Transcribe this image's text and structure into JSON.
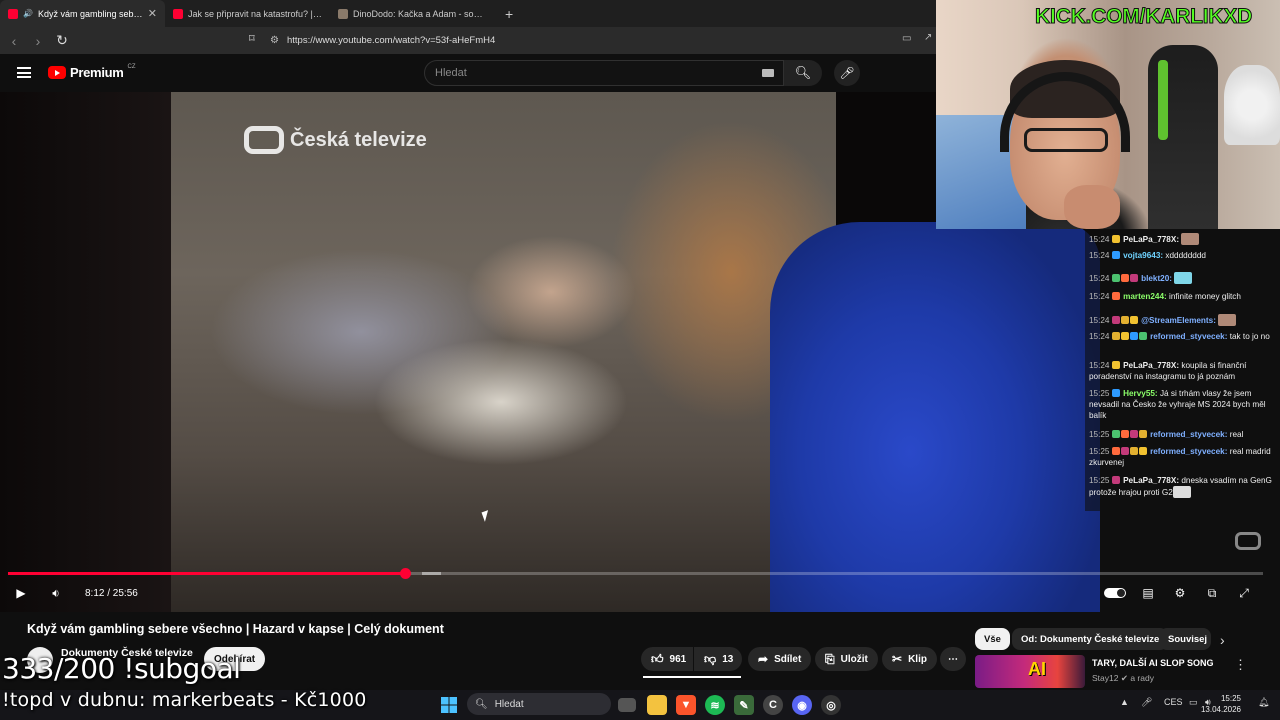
{
  "browser": {
    "tabs": [
      {
        "title": "Když vám gambling sebere vš",
        "active": true,
        "favicon_color": "#ff0033",
        "icon": "speaker-icon"
      },
      {
        "title": "Jak se připravit na katastrofu? | What",
        "active": false,
        "favicon_color": "#ff0033"
      },
      {
        "title": "DinoDodo: Kačka a Adam - sourozen",
        "active": false,
        "favicon_color": "#8a7a6a"
      }
    ],
    "new_tab": "+",
    "url": "https://www.youtube.com/watch?v=53f-aHeFmH4"
  },
  "youtube": {
    "brand": "Premium",
    "region": "CZ",
    "search_placeholder": "Hledat"
  },
  "video": {
    "watermark": "Česká televize",
    "time": "8:12 / 25:56",
    "progress_fraction": 0.316,
    "buffer_from": 0.33,
    "buffer_to": 0.345,
    "title": "Když vám gambling sebere všechno | Hazard v kapse | Celý dokument",
    "channel": "Dokumenty České televize",
    "subscribe": "Odebírat",
    "likes": "961",
    "dislikes": "13",
    "share": "Sdílet",
    "save": "Uložit",
    "clip": "Klip",
    "more": "⋯"
  },
  "recommendations": {
    "chips": [
      "Vše",
      "Od: Dokumenty České televize",
      "Souvisej"
    ],
    "items": [
      {
        "title": "TARY, DALŠÍ AI SLOP SONG",
        "channel": "Stay12",
        "meta": "a rady",
        "thumb_text": "AI"
      }
    ]
  },
  "stream": {
    "kick_url": "KICK.COM/KARLIKXD",
    "overlay_subgoal": "333/200 !subgoal",
    "overlay_topd": "!topd v dubnu: markerbeats - Kč1000"
  },
  "chat": [
    {
      "time": "15:24",
      "user": "PeLaPa_778X:",
      "color": "#eeeeee",
      "text": ""
    },
    {
      "time": "15:24",
      "user": "vojta9643:",
      "color": "#6fd3ff",
      "text": "xdddddddd"
    },
    {
      "time": "15:24",
      "user": "blekt20:",
      "color": "#7fb0ff",
      "text": ""
    },
    {
      "time": "15:24",
      "user": "marten244:",
      "color": "#8cff6a",
      "text": "infinite money glitch"
    },
    {
      "time": "15:24",
      "user": "@StreamElements:",
      "color": "#7fb0ff",
      "text": ""
    },
    {
      "time": "15:24",
      "user": "reformed_styvecek:",
      "color": "#7fb0ff",
      "text": "tak to jo no"
    },
    {
      "time": "15:24",
      "user": "PeLaPa_778X:",
      "color": "#eeeeee",
      "text": "koupila si finanční poradenství na instagramu to já poznám"
    },
    {
      "time": "15:25",
      "user": "Hervy55:",
      "color": "#8cff6a",
      "text": "Já si trhám vlasy že jsem nevsadil na Česko že vyhraje MS 2024 bych měl balík"
    },
    {
      "time": "15:25",
      "user": "reformed_styvecek:",
      "color": "#7fb0ff",
      "text": "real"
    },
    {
      "time": "15:25",
      "user": "reformed_styvecek:",
      "color": "#7fb0ff",
      "text": "real madrid zkurvenej"
    },
    {
      "time": "15:25",
      "user": "PeLaPa_778X:",
      "color": "#eeeeee",
      "text": "dneska vsadím na GenG protože hrajou proti G2"
    }
  ],
  "taskbar": {
    "search": "Hledat",
    "lang": "CES",
    "time": "15:25",
    "date": "13.04.2026"
  }
}
